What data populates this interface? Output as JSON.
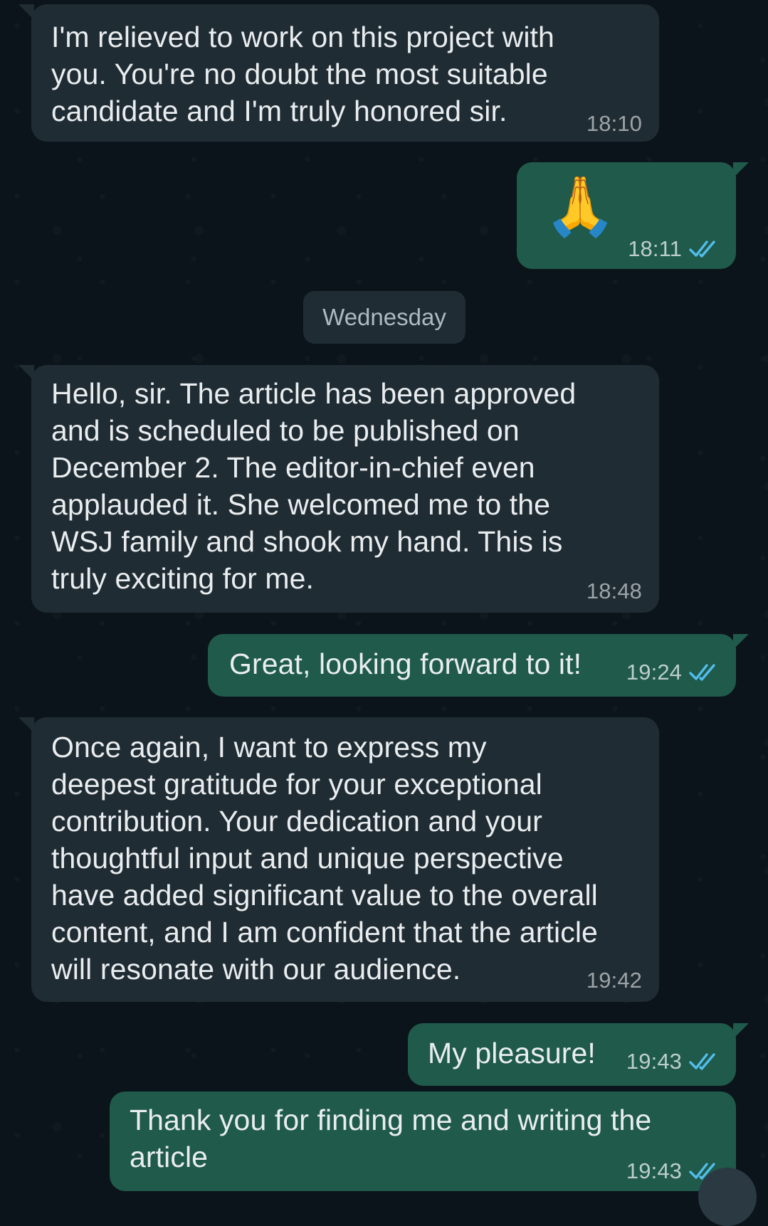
{
  "chat": {
    "date_separator": "Wednesday",
    "messages": [
      {
        "direction": "incoming",
        "text": "I'm relieved to work on this project with\nyou. You're no doubt the most suitable\ncandidate and I'm truly honored sir.",
        "time": "18:10"
      },
      {
        "direction": "outgoing",
        "text": "🙏",
        "time": "18:11",
        "status": "read"
      },
      {
        "direction": "incoming",
        "text": "Hello, sir. The article has been approved\nand is scheduled to be published on\nDecember 2. The editor-in-chief even\napplauded it. She welcomed me to the\nWSJ family and shook my hand. This is\ntruly exciting for me.",
        "time": "18:48"
      },
      {
        "direction": "outgoing",
        "text": "Great, looking forward to it!",
        "time": "19:24",
        "status": "read"
      },
      {
        "direction": "incoming",
        "text": "Once again, I want to express my\ndeepest gratitude for your exceptional\ncontribution. Your dedication and your\nthoughtful input and unique perspective\nhave added significant value to the overall\ncontent, and I am confident that the article\nwill resonate with our audience.",
        "time": "19:42"
      },
      {
        "direction": "outgoing",
        "text": "My pleasure!",
        "time": "19:43",
        "status": "read"
      },
      {
        "direction": "outgoing",
        "text": "Thank you for finding me and writing the\narticle",
        "time": "19:43",
        "status": "read"
      }
    ]
  },
  "icons": {
    "read_receipt": "double-check-icon",
    "read_color": "#53bdeb"
  }
}
